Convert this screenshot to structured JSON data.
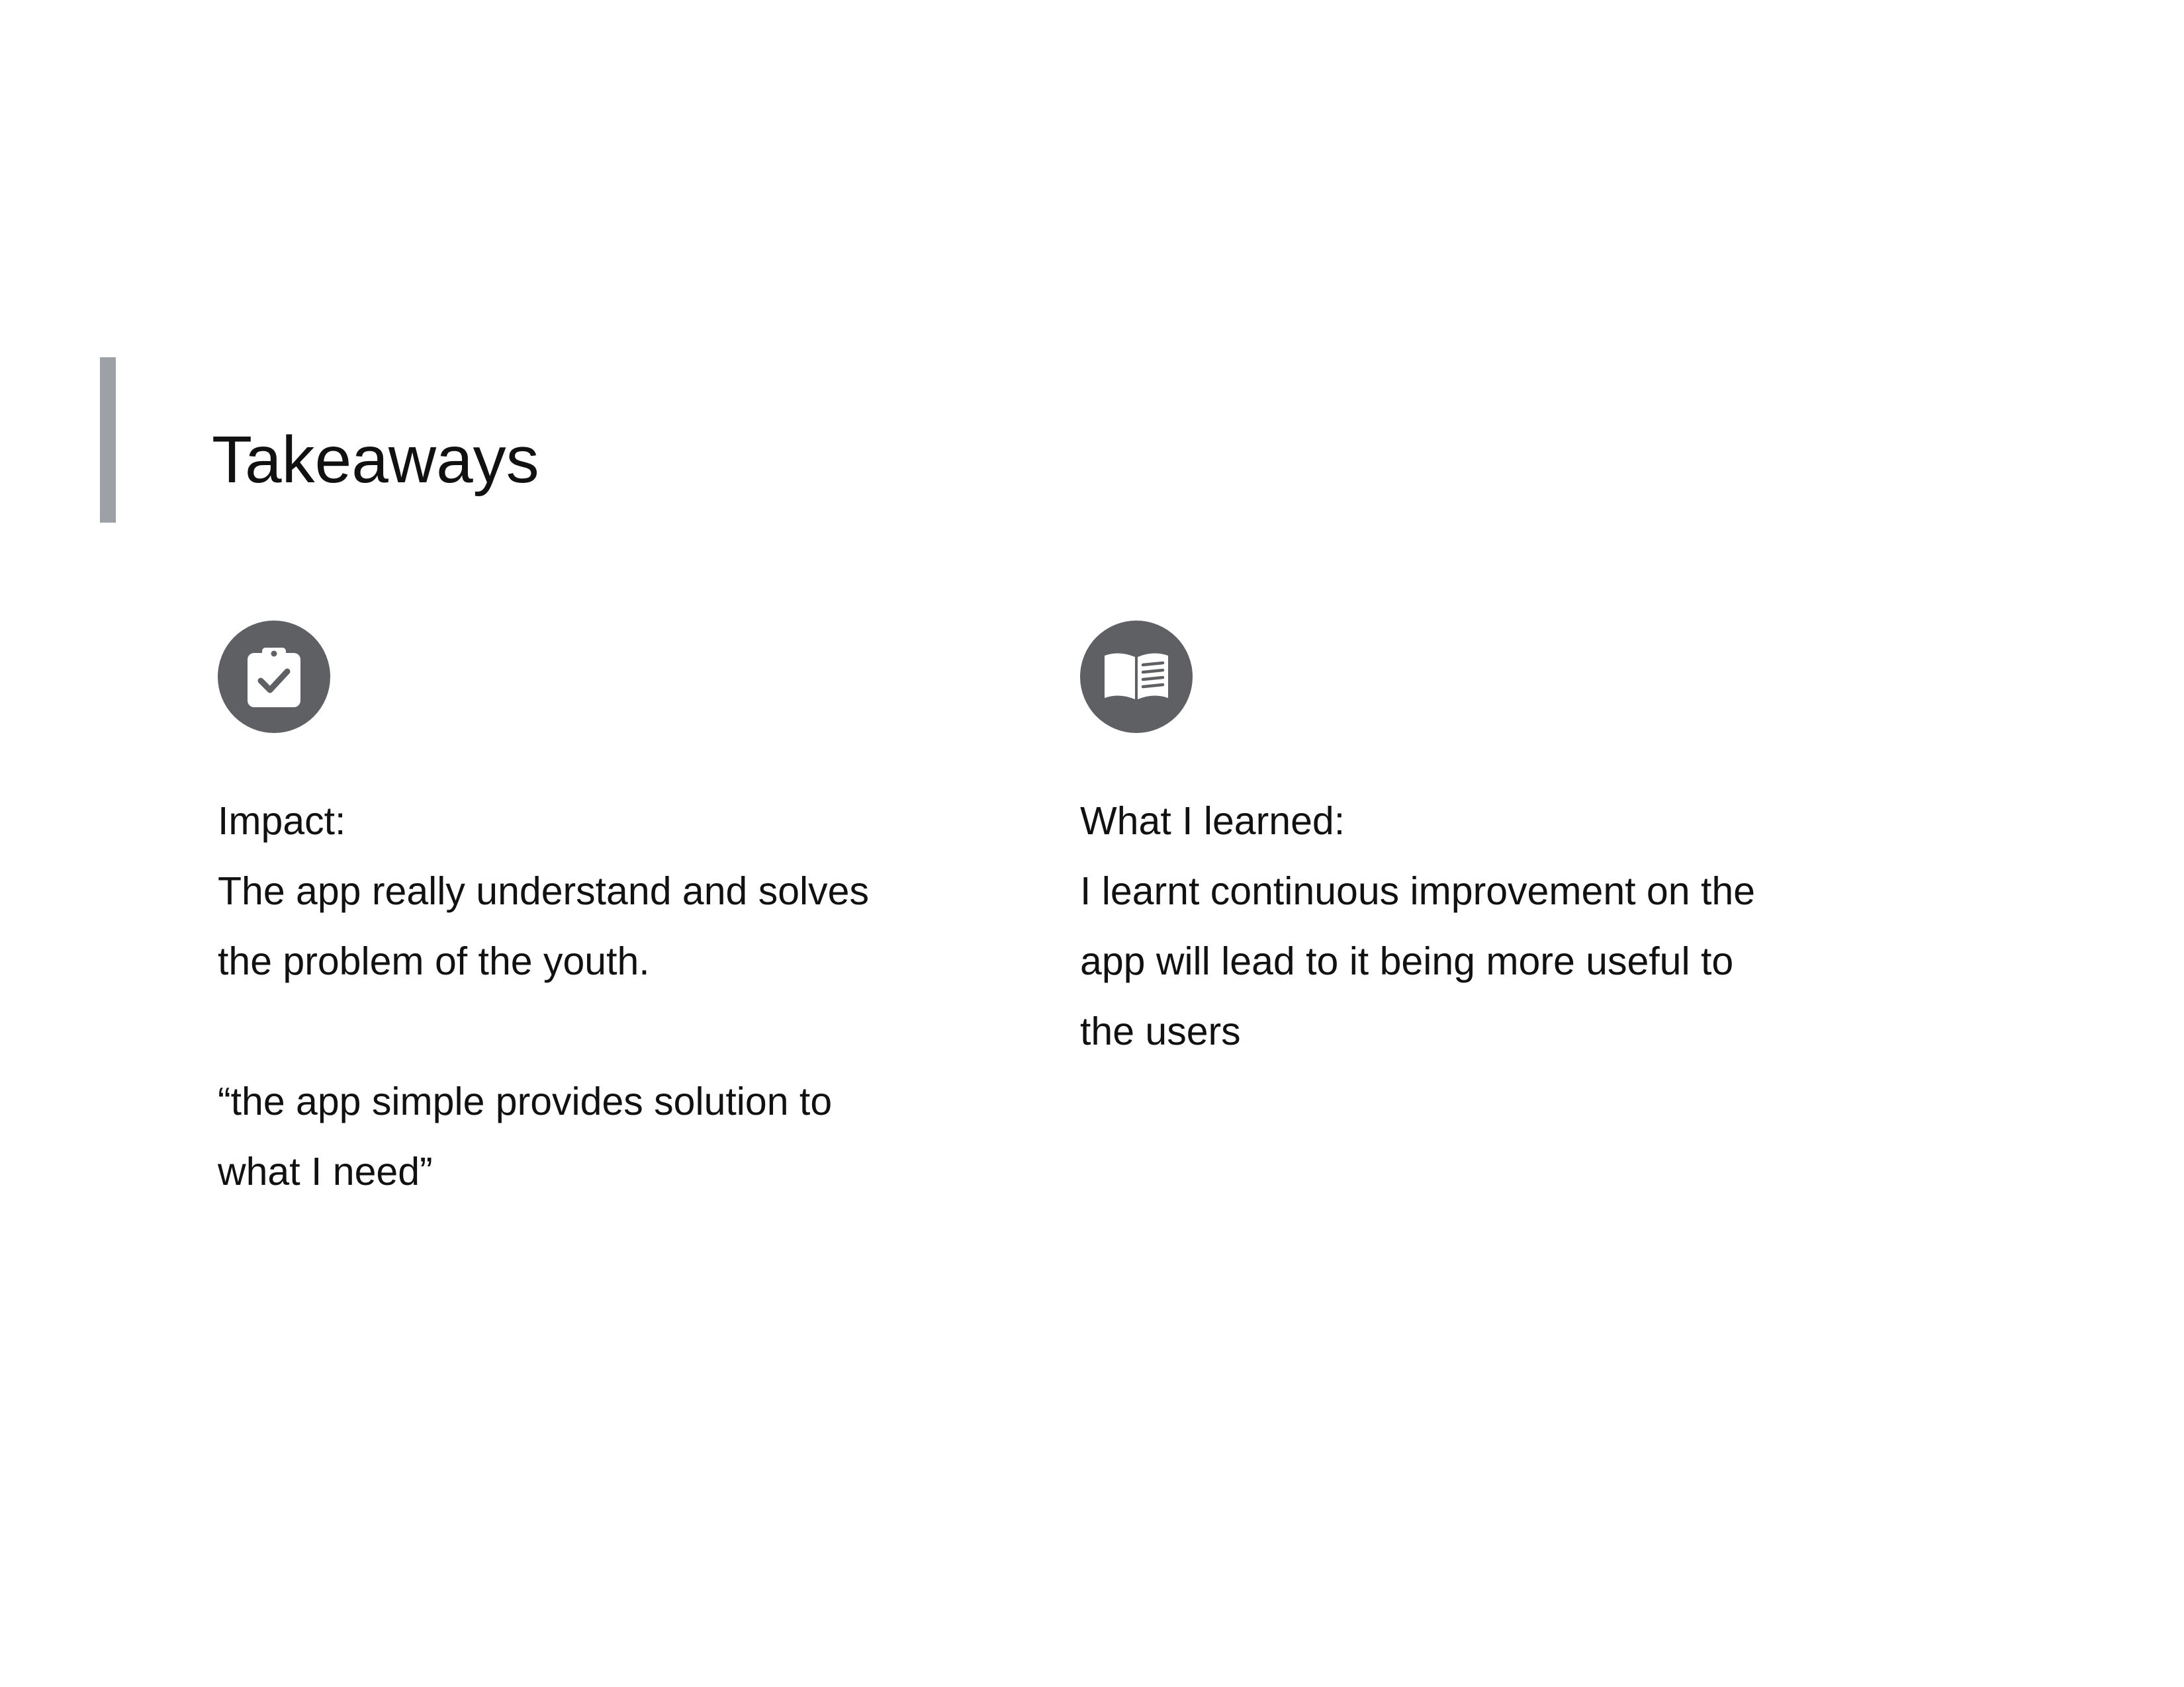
{
  "page": {
    "title": "Takeaways",
    "accent_color": "#9da0a6",
    "icon_bg_color": "#5f6064"
  },
  "sections": [
    {
      "icon": "clipboard-check-icon",
      "heading": "Impact:",
      "lines": [
        "The app really understand and solves",
        "the problem of the youth."
      ],
      "quote_lines": [
        "“the app simple provides solution to",
        "what I need”"
      ]
    },
    {
      "icon": "open-book-icon",
      "heading": "What I learned:",
      "lines": [
        "I learnt continuous improvement on the",
        "app will lead to it being more useful to",
        "the users"
      ]
    }
  ]
}
